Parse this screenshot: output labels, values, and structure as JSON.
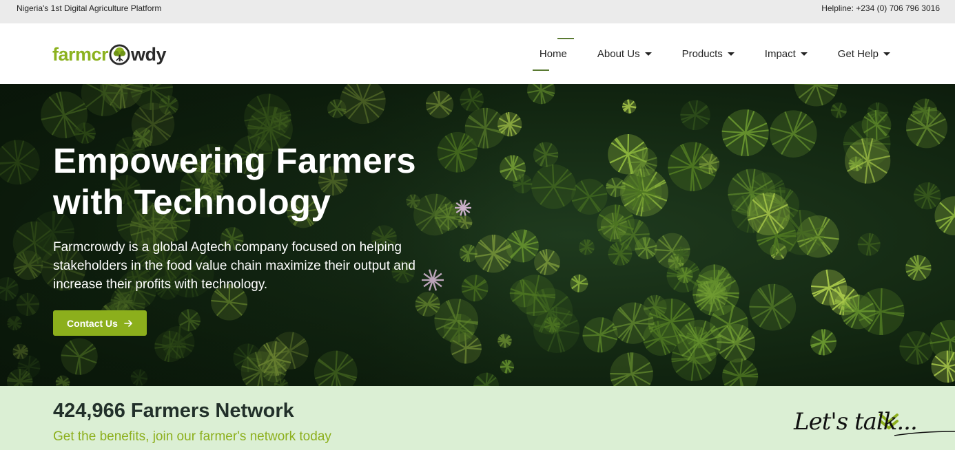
{
  "topbar": {
    "tagline": "Nigeria's 1st Digital Agriculture Platform",
    "helpline": "Helpline: +234 (0) 706 796 3016"
  },
  "logo": {
    "part1": "farmcr",
    "part2": "wdy",
    "icon": "tree-icon"
  },
  "nav": {
    "items": [
      {
        "label": "Home",
        "active": true,
        "dropdown": false
      },
      {
        "label": "About Us",
        "dropdown": true
      },
      {
        "label": "Products",
        "dropdown": true
      },
      {
        "label": "Impact",
        "dropdown": true
      },
      {
        "label": "Get Help",
        "dropdown": true
      }
    ]
  },
  "hero": {
    "title_line1": "Empowering Farmers",
    "title_line2": "with Technology",
    "description": "Farmcrowdy is a global Agtech company focused on helping stakeholders in the food value chain maximize their output and increase their profits with technology.",
    "cta_label": "Contact Us",
    "cta_icon": "arrow-right-icon"
  },
  "stats": {
    "headline": "424,966 Farmers Network",
    "subtext": "Get the benefits, join our farmer's network today"
  },
  "chat": {
    "label": "Let's talk..."
  },
  "colors": {
    "brand_green": "#8caf1c",
    "nav_accent": "#5a7a32",
    "stats_bg": "#dbefd4",
    "topbar_bg": "#ebebeb"
  }
}
